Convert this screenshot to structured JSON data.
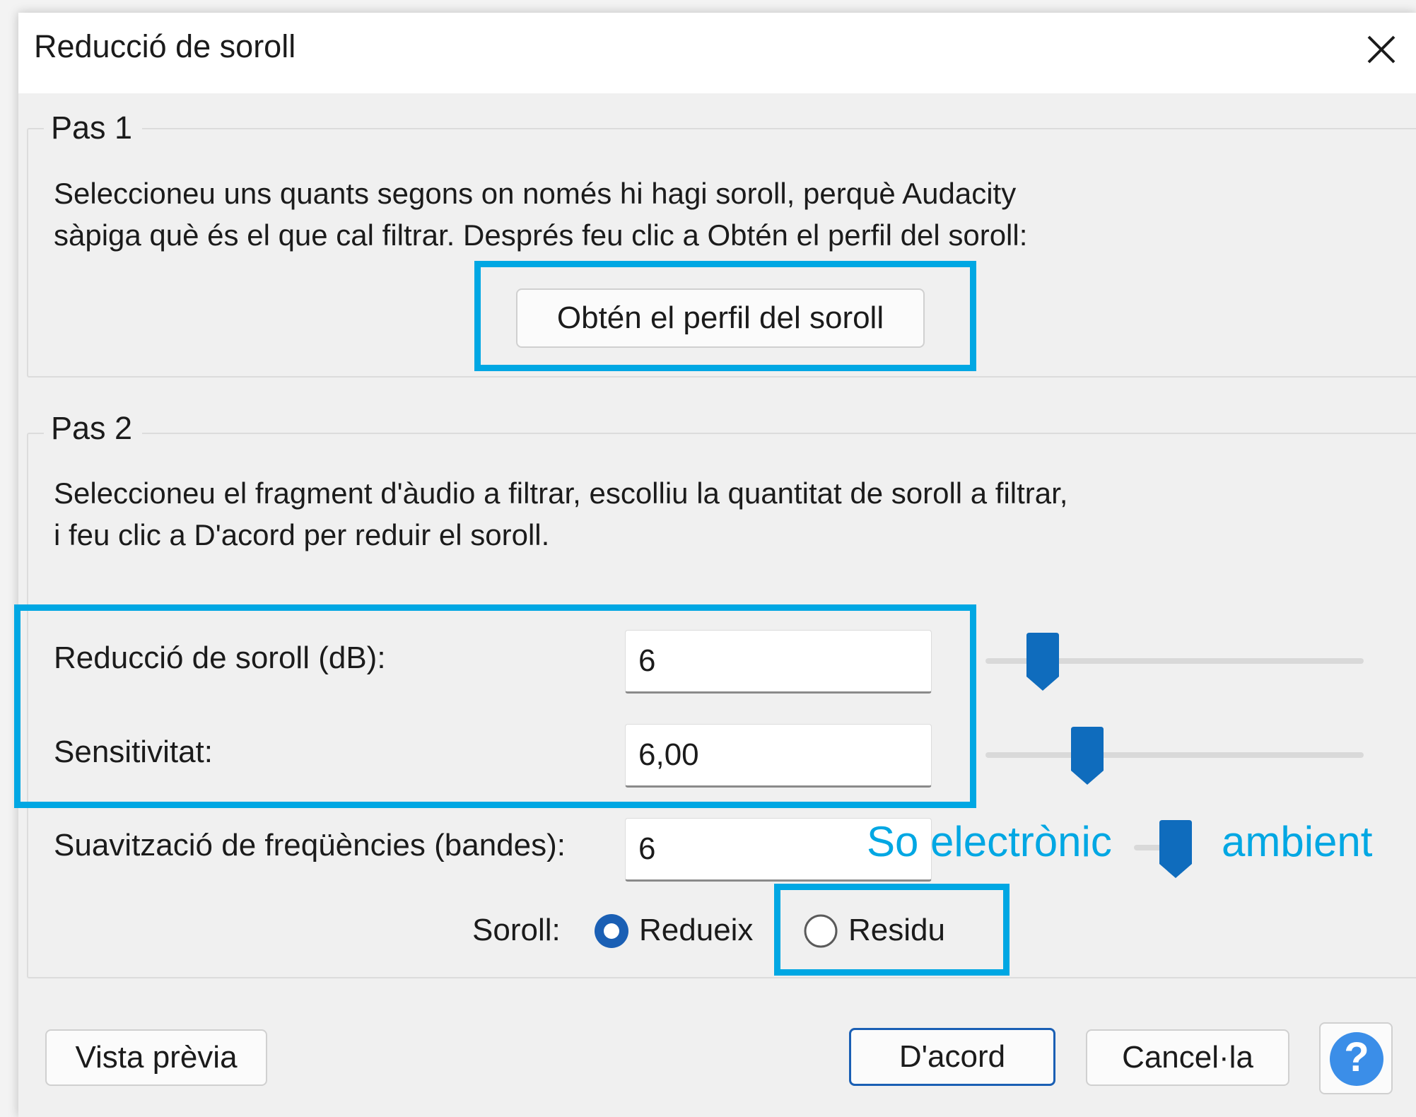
{
  "window": {
    "title": "Reducció de soroll"
  },
  "step1": {
    "legend": "Pas 1",
    "description_line1": "Seleccioneu uns quants segons on només hi hagi soroll, perquè Audacity",
    "description_line2": "sàpiga què és el que cal filtrar. Després feu clic a Obtén el perfil del soroll:",
    "get_profile_label": "Obtén el perfil del soroll"
  },
  "step2": {
    "legend": "Pas 2",
    "description_line1": "Seleccioneu el fragment d'àudio a filtrar, escolliu la quantitat de soroll a filtrar,",
    "description_line2": "i feu clic a D'acord per reduir el soroll.",
    "noise_reduction": {
      "label": "Reducció de soroll (dB):",
      "value": "6",
      "slider_level": 0.15
    },
    "sensitivity": {
      "label": "Sensitivitat:",
      "value": "6,00",
      "slider_level": 0.27
    },
    "frequency_smoothing": {
      "label": "Suavització de freqüències (bandes):",
      "value": "6",
      "slider_level": 0.5
    },
    "noise": {
      "label": "Soroll:",
      "options": [
        "Redueix",
        "Residu"
      ],
      "selected": "Redueix"
    }
  },
  "annotations": {
    "left": "So electrònic",
    "right": "ambient"
  },
  "buttons": {
    "preview": "Vista prèvia",
    "ok": "D'acord",
    "cancel": "Cancel·la",
    "help": "?"
  },
  "colors": {
    "accent": "#1a5fb4",
    "slider": "#0f6cbd",
    "highlight": "#00a7e3",
    "help": "#3b8ee8"
  },
  "icons": {
    "close": "close-icon",
    "help": "help-icon"
  }
}
